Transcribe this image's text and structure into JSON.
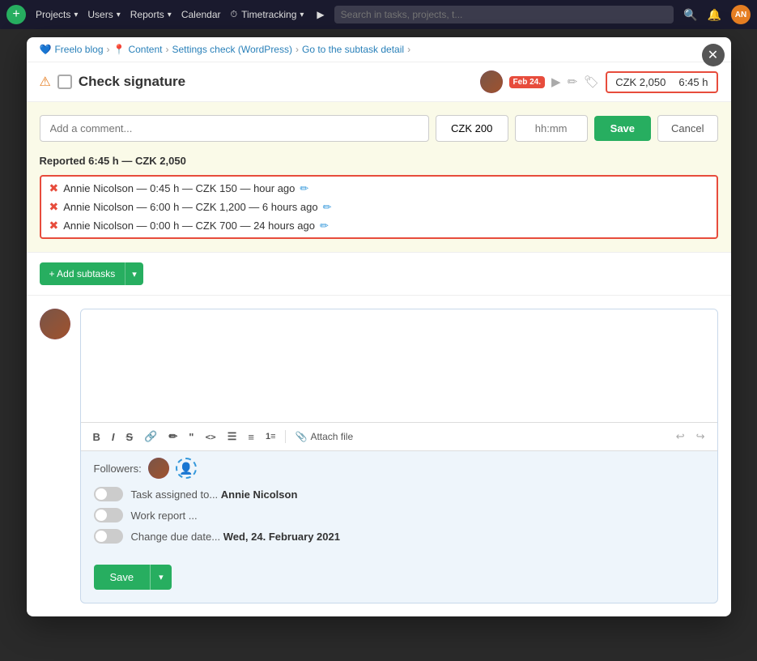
{
  "topnav": {
    "plus_label": "+",
    "projects_label": "Projects",
    "users_label": "Users",
    "reports_label": "Reports",
    "calendar_label": "Calendar",
    "timetracking_label": "Timetracking",
    "search_placeholder": "Search in tasks, projects, t...",
    "chevron": "▾"
  },
  "breadcrumb": {
    "blog": "Freelo blog",
    "blog_icon": "💙",
    "content": "Content",
    "pin_icon": "📍",
    "settings": "Settings check (WordPress)",
    "subtask": "Go to the subtask detail"
  },
  "task": {
    "title": "Check signature",
    "date_badge": "Feb 24.",
    "time_display": "CZK 2,050",
    "hours_display": "6:45 h"
  },
  "time_panel": {
    "comment_placeholder": "Add a comment...",
    "money_value": "CZK 200",
    "hours_placeholder": "hh:mm",
    "save_label": "Save",
    "cancel_label": "Cancel",
    "reported_label": "Reported 6:45 h — CZK 2,050",
    "entries": [
      {
        "text": "Annie Nicolson — 0:45 h — CZK 150 — hour ago"
      },
      {
        "text": "Annie Nicolson — 6:00 h — CZK 1,200 — 6 hours ago"
      },
      {
        "text": "Annie Nicolson — 0:00 h — CZK 700 — 24 hours ago"
      }
    ]
  },
  "subtasks": {
    "add_label": "+ Add subtasks",
    "dropdown_icon": "▾"
  },
  "comment": {
    "toolbar": {
      "bold": "B",
      "italic": "I",
      "strikethrough": "S",
      "link": "🔗",
      "brush": "✏",
      "quote": "❝",
      "code_inline": "<>",
      "list_ordered": "≡",
      "list_bullet": "•≡",
      "list_num": "1≡",
      "attach_label": "Attach file",
      "undo": "↩",
      "redo": "↪"
    }
  },
  "followers": {
    "label": "Followers:",
    "add_tooltip": "Add follower"
  },
  "notifications": [
    {
      "text": "Task assigned to...",
      "bold": "Annie Nicolson"
    },
    {
      "text": "Work report ...",
      "bold": ""
    },
    {
      "text": "Change due date...",
      "bold": "Wed, 24. February 2021"
    }
  ],
  "save_btn": {
    "label": "Save"
  }
}
